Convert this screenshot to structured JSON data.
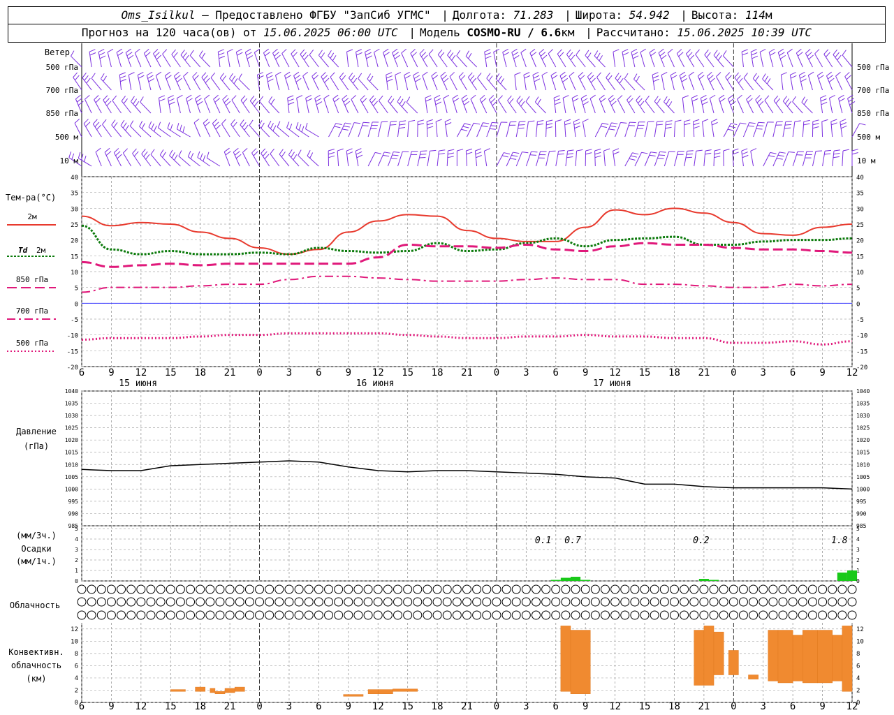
{
  "header": {
    "station": "Oms_Isilkul",
    "provider": "– Предоставлено ФГБУ \"ЗапСиб УГМС\"",
    "lon_label": "Долгота:",
    "lon_value": "71.283",
    "lat_label": "Широта:",
    "lat_value": "54.942",
    "alt_label": "Высота:",
    "alt_value": "114",
    "alt_unit": "м",
    "forecast_label": "Прогноз на 120 часа(ов) от",
    "forecast_start": "15.06.2025 06:00 UTC",
    "model_label": "Модель",
    "model_name": "COSMO-RU / 6.6",
    "model_unit": "км",
    "calc_label": "Рассчитано:",
    "calc_time": "15.06.2025 10:39 UTC"
  },
  "colors": {
    "t2m": "#e83a2e",
    "td2m": "#0b7a0b",
    "t850": "#e0187a",
    "t700": "#e0187a",
    "t500": "#e0187a",
    "wind": "#7b2fe0",
    "pressure": "#000000",
    "precip": "#19c919",
    "convective": "#f08a30",
    "zero_line": "#3b3bff"
  },
  "chart_data": [
    {
      "type": "barbs",
      "panel": "wind",
      "title": "Ветер",
      "levels": [
        "500 гПа",
        "700 гПа",
        "850 гПа",
        "500 м",
        "10 м"
      ]
    },
    {
      "type": "line",
      "panel": "temperature",
      "ylabel": "Тем-ра(°C)",
      "ylim": [
        -20,
        40
      ],
      "yticks": [
        40,
        35,
        30,
        25,
        20,
        15,
        10,
        5,
        0,
        -5,
        -10,
        -15,
        -20
      ],
      "x_hours": [
        0,
        3,
        6,
        9,
        12,
        15,
        18,
        21,
        24,
        27,
        30,
        33,
        36,
        39,
        42,
        45,
        48,
        51,
        54,
        57,
        60,
        63,
        66,
        69,
        72,
        75,
        78
      ],
      "series": [
        {
          "name": "2м",
          "style": "solid",
          "values": [
            27.5,
            24.5,
            25.5,
            25.0,
            22.5,
            20.5,
            17.5,
            15.5,
            17.0,
            22.5,
            26.0,
            28.0,
            27.5,
            23.0,
            20.5,
            19.5,
            19.5,
            24.0,
            29.5,
            28.0,
            30.0,
            28.5,
            25.5,
            22.0,
            21.5,
            24.0,
            25.0
          ]
        },
        {
          "name": "Td 2м",
          "style": "short-dash",
          "values": [
            24.5,
            17.0,
            15.5,
            16.5,
            15.5,
            15.5,
            16.0,
            15.5,
            17.5,
            16.5,
            16.0,
            16.5,
            19.0,
            16.5,
            17.0,
            19.0,
            20.5,
            18.0,
            20.0,
            20.5,
            21.0,
            18.5,
            18.5,
            19.5,
            20.0,
            20.0,
            20.5
          ]
        },
        {
          "name": "850 гПа",
          "style": "long-dash",
          "values": [
            13.0,
            11.5,
            12.0,
            12.5,
            12.0,
            12.5,
            12.5,
            12.5,
            12.5,
            12.5,
            14.5,
            18.5,
            18.0,
            18.0,
            17.5,
            18.5,
            17.0,
            16.5,
            18.0,
            19.0,
            18.5,
            18.5,
            17.5,
            17.0,
            17.0,
            16.5,
            16.0
          ]
        },
        {
          "name": "700 гПа",
          "style": "dash-dot",
          "values": [
            3.5,
            5.0,
            5.0,
            5.0,
            5.5,
            6.0,
            6.0,
            7.5,
            8.5,
            8.5,
            8.0,
            7.5,
            7.0,
            7.0,
            7.0,
            7.5,
            8.0,
            7.5,
            7.5,
            6.0,
            6.0,
            5.5,
            5.0,
            5.0,
            6.0,
            5.5,
            6.0
          ]
        },
        {
          "name": "500 гПа",
          "style": "dot",
          "values": [
            -11.5,
            -11.0,
            -11.0,
            -11.0,
            -10.5,
            -10.0,
            -10.0,
            -9.5,
            -9.5,
            -9.5,
            -9.5,
            -10.0,
            -10.5,
            -11.0,
            -11.0,
            -10.5,
            -10.5,
            -10.0,
            -10.5,
            -10.5,
            -11.0,
            -11.0,
            -12.5,
            -12.5,
            -12.0,
            -13.0,
            -12.0
          ]
        }
      ]
    },
    {
      "type": "line",
      "panel": "pressure",
      "ylabel": "Давление",
      "unit": "(гПа)",
      "ylim": [
        985,
        1040
      ],
      "yticks": [
        1040,
        1035,
        1030,
        1025,
        1020,
        1015,
        1010,
        1005,
        1000,
        995,
        990,
        985
      ],
      "x_hours": [
        0,
        3,
        6,
        9,
        12,
        15,
        18,
        21,
        24,
        27,
        30,
        33,
        36,
        39,
        42,
        45,
        48,
        51,
        54,
        57,
        60,
        63,
        66,
        69,
        72,
        75,
        78
      ],
      "values": [
        1008.0,
        1007.5,
        1007.5,
        1009.5,
        1010.0,
        1010.5,
        1011.0,
        1011.5,
        1011.0,
        1009.0,
        1007.5,
        1007.0,
        1007.5,
        1007.5,
        1007.0,
        1006.5,
        1006.0,
        1005.0,
        1004.5,
        1002.0,
        1002.0,
        1001.0,
        1000.5,
        1000.5,
        1000.5,
        1000.5,
        1000.0
      ]
    },
    {
      "type": "bar",
      "panel": "precipitation",
      "ylabel": "Осадки",
      "unit_3h": "(мм/3ч.)",
      "unit_1h": "(мм/1ч.)",
      "ylim": [
        0,
        5
      ],
      "labels": [
        "0.1",
        "0.7",
        "0.2",
        "1.8"
      ],
      "bars": [
        {
          "hour": 48,
          "value": 0.1
        },
        {
          "hour": 49,
          "value": 0.3
        },
        {
          "hour": 50,
          "value": 0.4
        },
        {
          "hour": 51,
          "value": 0.1
        },
        {
          "hour": 63,
          "value": 0.2
        },
        {
          "hour": 64,
          "value": 0.1
        },
        {
          "hour": 77,
          "value": 0.8
        },
        {
          "hour": 78,
          "value": 1.0
        }
      ]
    },
    {
      "type": "symbols",
      "panel": "cloudiness",
      "label": "Облачность",
      "rows": [
        {
          "name": "high",
          "fractions": [
            0,
            0,
            0,
            0,
            0,
            0,
            0,
            0,
            0,
            0,
            0,
            0,
            0,
            0,
            0,
            0,
            0,
            0,
            0,
            0,
            0,
            0,
            0,
            0,
            0,
            0,
            0,
            0,
            0,
            0,
            0,
            0,
            0,
            0,
            0,
            0,
            0,
            0,
            0,
            0,
            0,
            0,
            0,
            0,
            0,
            0,
            0,
            0,
            0,
            0,
            0,
            0,
            0,
            0,
            0,
            0,
            0,
            0,
            0,
            0,
            0,
            0,
            0,
            0,
            0,
            0,
            0,
            0,
            0,
            0,
            0,
            0,
            0,
            0,
            0,
            0,
            0,
            0,
            0
          ]
        },
        {
          "name": "middle",
          "fractions": [
            0,
            0,
            0,
            0,
            0,
            0,
            0,
            0,
            0,
            0,
            0,
            0,
            0,
            0,
            0,
            0,
            0,
            0,
            0,
            0,
            0,
            0,
            0,
            0,
            0,
            0,
            0,
            0,
            0,
            0,
            0,
            0,
            0,
            0,
            0,
            0,
            0,
            0,
            0,
            0,
            0,
            0,
            0,
            0,
            0,
            0,
            0,
            0,
            0,
            0,
            0,
            0,
            0,
            0,
            0,
            0,
            0,
            0,
            0,
            0,
            0,
            0,
            0,
            0,
            0,
            0,
            0,
            0,
            0,
            0,
            0,
            0,
            0,
            0,
            0,
            0,
            0,
            0,
            0
          ]
        },
        {
          "name": "low",
          "fractions": [
            0,
            0,
            0,
            0,
            0,
            0,
            0,
            0,
            0,
            0,
            0,
            0,
            0,
            0,
            0,
            0,
            0,
            0,
            0,
            0,
            0,
            0,
            0,
            0,
            0,
            0,
            0,
            0,
            0,
            0,
            0,
            0,
            0,
            0,
            0,
            0,
            0,
            0,
            0,
            0,
            0,
            0,
            0,
            0,
            0,
            0,
            0,
            0,
            0,
            0,
            0,
            0,
            0,
            0,
            0,
            0,
            0,
            0,
            0,
            0,
            0,
            0,
            0,
            0,
            0,
            0,
            0,
            0,
            0,
            0,
            0,
            0,
            0,
            0,
            0,
            0,
            0,
            0,
            0
          ]
        }
      ]
    },
    {
      "type": "bar",
      "panel": "convective",
      "ylabel": "Конвективн. облачность (км)",
      "ylabel_lines": [
        "Конвективн.",
        "облачность",
        "(км)"
      ],
      "ylim": [
        0,
        13
      ],
      "yticks": [
        12,
        10,
        8,
        6,
        4,
        2,
        0
      ],
      "ranges": [
        {
          "from_hour": 9,
          "to_hour": 10.5,
          "bottom": 1.8,
          "top": 2.1
        },
        {
          "from_hour": 11.5,
          "to_hour": 12.5,
          "bottom": 1.8,
          "top": 2.5
        },
        {
          "from_hour": 13,
          "to_hour": 13.5,
          "bottom": 1.6,
          "top": 2.3
        },
        {
          "from_hour": 13.5,
          "to_hour": 14.5,
          "bottom": 1.4,
          "top": 1.8
        },
        {
          "from_hour": 14.5,
          "to_hour": 15.5,
          "bottom": 1.6,
          "top": 2.3
        },
        {
          "from_hour": 15.5,
          "to_hour": 16.5,
          "bottom": 1.8,
          "top": 2.5
        },
        {
          "from_hour": 26.5,
          "to_hour": 28.5,
          "bottom": 1.0,
          "top": 1.3
        },
        {
          "from_hour": 29,
          "to_hour": 30,
          "bottom": 1.4,
          "top": 2.1
        },
        {
          "from_hour": 30,
          "to_hour": 31.5,
          "bottom": 1.4,
          "top": 2.1
        },
        {
          "from_hour": 31.5,
          "to_hour": 34,
          "bottom": 1.8,
          "top": 2.2
        },
        {
          "from_hour": 48.5,
          "to_hour": 49.5,
          "bottom": 1.8,
          "top": 12.5
        },
        {
          "from_hour": 49.5,
          "to_hour": 51.5,
          "bottom": 1.4,
          "top": 11.8
        },
        {
          "from_hour": 62,
          "to_hour": 63,
          "bottom": 2.8,
          "top": 11.8
        },
        {
          "from_hour": 63,
          "to_hour": 64,
          "bottom": 2.8,
          "top": 12.5
        },
        {
          "from_hour": 64,
          "to_hour": 65,
          "bottom": 4.5,
          "top": 11.5
        },
        {
          "from_hour": 65.5,
          "to_hour": 66.5,
          "bottom": 4.5,
          "top": 8.5
        },
        {
          "from_hour": 67.5,
          "to_hour": 68.5,
          "bottom": 3.8,
          "top": 4.5
        },
        {
          "from_hour": 69.5,
          "to_hour": 70.5,
          "bottom": 3.5,
          "top": 11.8
        },
        {
          "from_hour": 70.5,
          "to_hour": 72,
          "bottom": 3.2,
          "top": 11.8
        },
        {
          "from_hour": 72,
          "to_hour": 73,
          "bottom": 3.5,
          "top": 11.0
        },
        {
          "from_hour": 73,
          "to_hour": 74.5,
          "bottom": 3.2,
          "top": 11.8
        },
        {
          "from_hour": 74.5,
          "to_hour": 76,
          "bottom": 3.2,
          "top": 11.8
        },
        {
          "from_hour": 76,
          "to_hour": 77,
          "bottom": 3.5,
          "top": 11.0
        },
        {
          "from_hour": 77,
          "to_hour": 78,
          "bottom": 1.8,
          "top": 12.5
        }
      ]
    }
  ],
  "x_axis": {
    "tick_labels": [
      "6",
      "9",
      "12",
      "15",
      "18",
      "21",
      "0",
      "3",
      "6",
      "9",
      "12",
      "15",
      "18",
      "21",
      "0",
      "3",
      "6",
      "9",
      "12",
      "15",
      "18",
      "21",
      "0",
      "3",
      "6",
      "9",
      "12"
    ],
    "dates": [
      "15 июня",
      "16 июня",
      "17 июня"
    ]
  }
}
